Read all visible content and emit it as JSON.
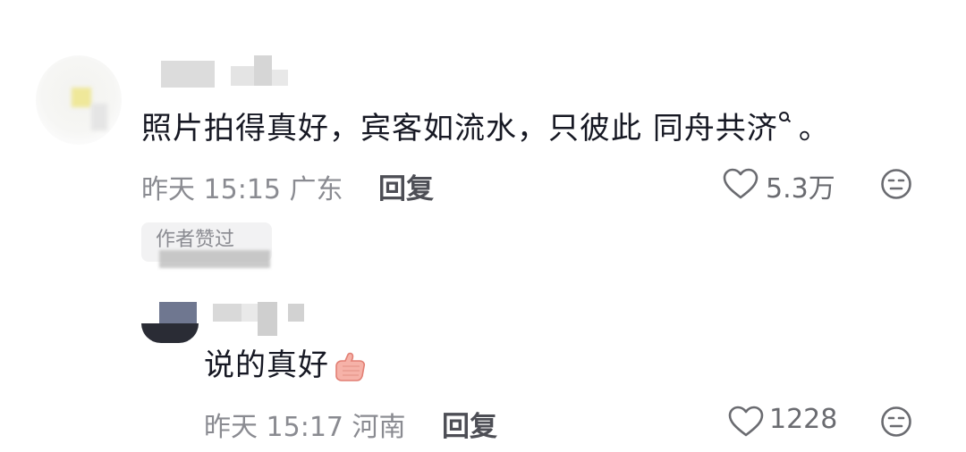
{
  "comment": {
    "text_before": "照片拍得真好，宾客如流水，只彼此 ",
    "keyword": "同舟共济",
    "text_after": "。",
    "time": "昨天 15:15",
    "location": "广东",
    "reply_label": "回复",
    "likes": "5.3万",
    "author_liked_badge": "作者赞过"
  },
  "reply": {
    "text": "说的真好",
    "time": "昨天 15:17",
    "location": "河南",
    "reply_label": "回复",
    "likes": "1228"
  },
  "icons": {
    "like": "heart-outline-icon",
    "dislike": "dislike-face-icon",
    "search": "search-icon",
    "emoji": "thumbs-up-emoji"
  },
  "colors": {
    "text": "#161823",
    "meta": "#8a8b91",
    "icon": "#6a6b70"
  }
}
